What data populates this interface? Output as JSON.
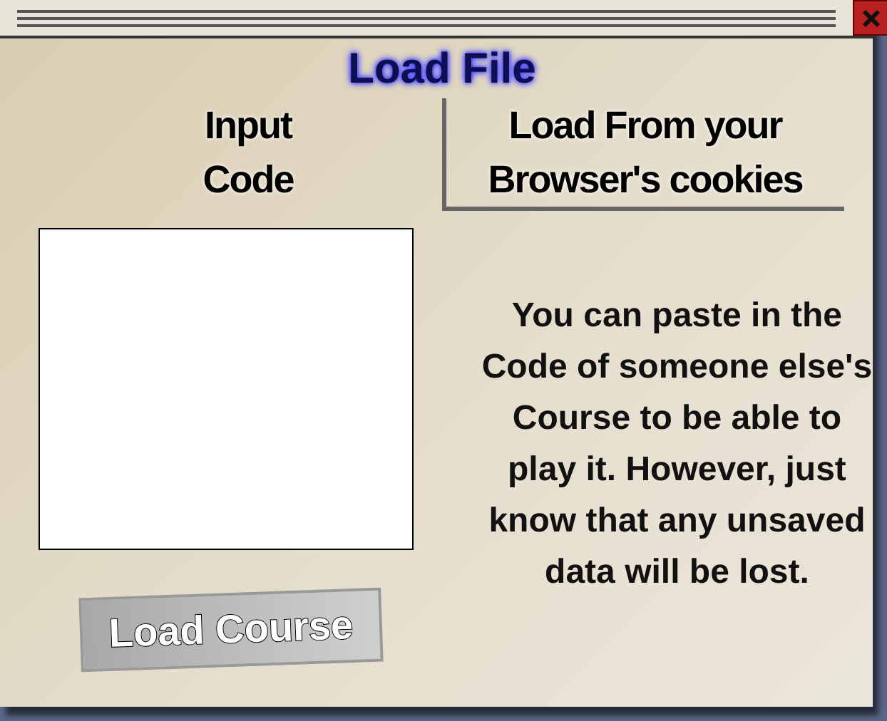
{
  "window": {
    "title": "Load File"
  },
  "tabs": [
    {
      "label": "Input Code",
      "selected": true
    },
    {
      "label": "Load From your Browser's cookies",
      "selected": false
    }
  ],
  "button": "Load Course",
  "description": "You can paste in the Code of someone else's Course to be able to play it. However, just know that any unsaved data will be lost."
}
